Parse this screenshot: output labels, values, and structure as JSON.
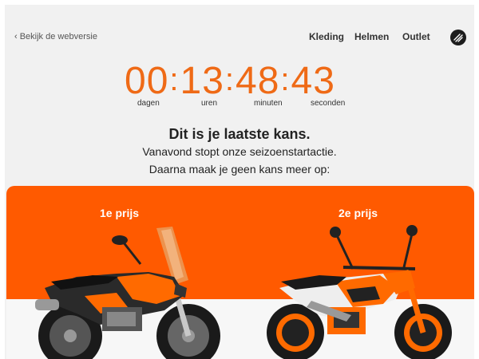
{
  "header": {
    "webversie_label": "‹ Bekijk de webversie",
    "nav": [
      "Kleding",
      "Helmen",
      "Outlet"
    ],
    "logo_icon": "brand-logo-icon"
  },
  "countdown": {
    "days": "00",
    "hours": "13",
    "minutes": "48",
    "seconds": "43",
    "labels": [
      "dagen",
      "uren",
      "minuten",
      "seconden"
    ],
    "color": "#ef6a16"
  },
  "message": {
    "headline": "Dit is je laatste kans.",
    "line1": "Vanavond stopt onze seizoenstartactie.",
    "line2": "Daarna maak je geen kans meer op:"
  },
  "prizes": [
    {
      "title": "1e prijs",
      "image_icon": "adventure-motorcycle-icon"
    },
    {
      "title": "2e prijs",
      "image_icon": "supermoto-motorcycle-icon"
    }
  ],
  "colors": {
    "accent": "#ff5a00",
    "background": "#f1f1f1"
  }
}
